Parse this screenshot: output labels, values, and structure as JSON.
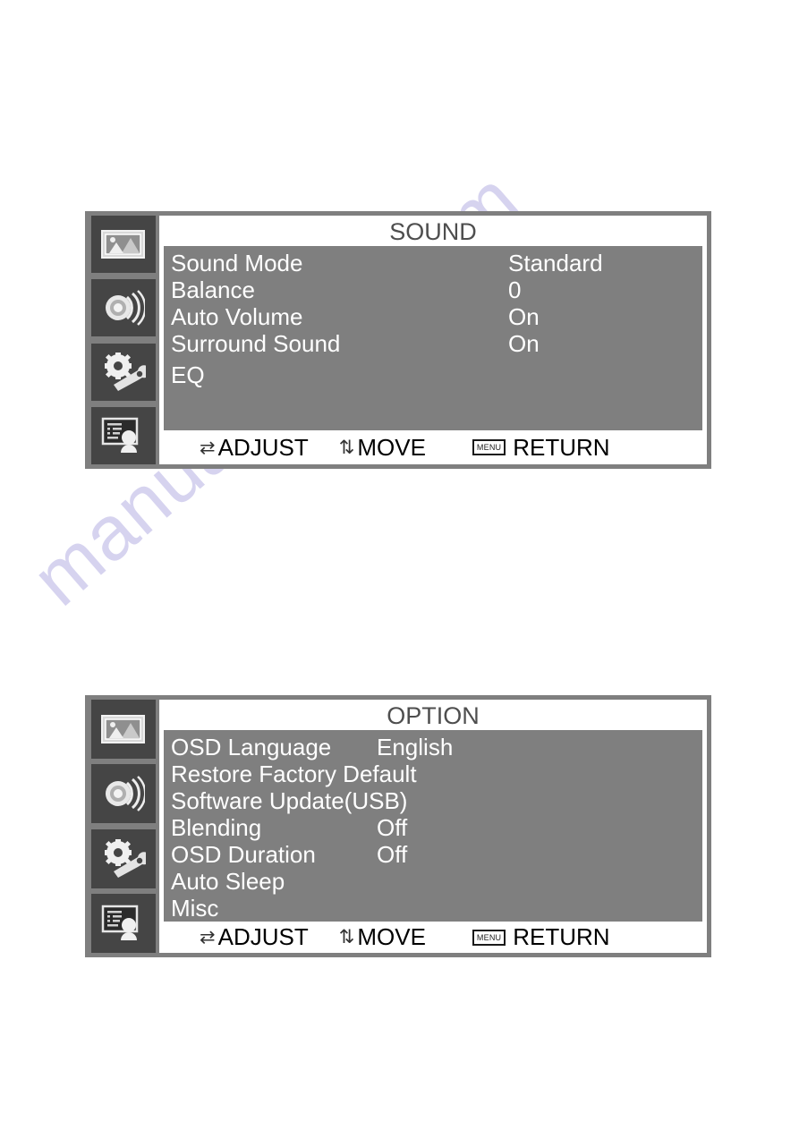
{
  "watermark": {
    "text": "manualshive.com",
    "color": "#d6d3ef"
  },
  "colors": {
    "panel_frame": "#7f7f7f",
    "sidebar_tile": "#454545",
    "content_bg": "#7f7f7f",
    "title_bg": "#ffffff",
    "title_text": "#4e4e4e",
    "item_text": "#ffffff",
    "footer_text": "#000000"
  },
  "sidebar": {
    "items": [
      {
        "icon": "picture-icon",
        "name": "picture"
      },
      {
        "icon": "sound-icon",
        "name": "sound"
      },
      {
        "icon": "settings-gear-wrench-icon",
        "name": "settings"
      },
      {
        "icon": "option-monitor-person-icon",
        "name": "option"
      }
    ]
  },
  "footer": {
    "adjust_glyph": "⇄",
    "adjust_label": "ADJUST",
    "move_glyph": "⇅",
    "move_label": "MOVE",
    "menu_key_label": "MENU",
    "return_label": "RETURN"
  },
  "sound_menu": {
    "title": "SOUND",
    "rows": [
      {
        "label": "Sound Mode",
        "value": "Standard"
      },
      {
        "label": "Balance",
        "value": "0"
      },
      {
        "label": "Auto Volume",
        "value": "On"
      },
      {
        "label": "Surround Sound",
        "value": "On"
      },
      {
        "label": "EQ",
        "value": ""
      }
    ]
  },
  "option_menu": {
    "title": "OPTION",
    "rows": [
      {
        "label": "OSD Language",
        "value": "English"
      },
      {
        "label": "Restore Factory Default",
        "value": ""
      },
      {
        "label": "Software Update(USB)",
        "value": ""
      },
      {
        "label": "Blending",
        "value": "Off"
      },
      {
        "label": "OSD Duration",
        "value": "Off"
      },
      {
        "label": "Auto Sleep",
        "value": ""
      },
      {
        "label": "Misc",
        "value": ""
      }
    ]
  }
}
